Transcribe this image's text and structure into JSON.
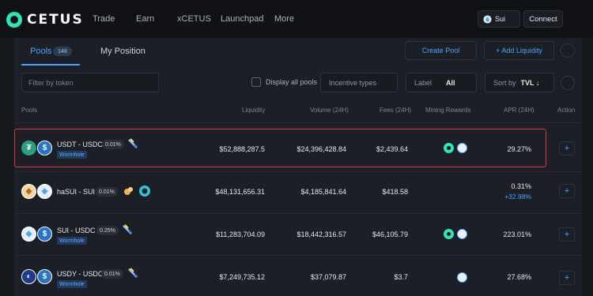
{
  "brand": {
    "name": "CETUS",
    "accent": "#2ee6b6",
    "link": "#4aa3ff",
    "highlight": "#e0323a"
  },
  "nav": {
    "items": [
      "Trade",
      "Earn",
      "xCETUS",
      "Launchpad",
      "More"
    ],
    "chain": "Sui",
    "connect": "Connect"
  },
  "tabs": {
    "pools": "Pools",
    "pools_count": "148",
    "my_position": "My Position"
  },
  "actions": {
    "create_pool": "Create Pool",
    "add_liquidity": "+ Add Liquidity"
  },
  "filters": {
    "token_placeholder": "Filter by token",
    "display_all": "Display all pools",
    "incentive": "Incentive types",
    "label_prefix": "Label",
    "label_value": "All",
    "sort_prefix": "Sort by",
    "sort_value": "TVL ↓"
  },
  "columns": [
    "Pools",
    "Liquidity",
    "Volume (24H)",
    "Fees (24H)",
    "Mining Rewards",
    "APR (24H)",
    "Action"
  ],
  "pools": [
    {
      "pair": "USDT - USDC",
      "fee": "0.01%",
      "badge": "Wormhole",
      "coin_a": "usdt-icon",
      "coin_b": "usdc-icon",
      "liquidity": "$52,888,287.5",
      "volume": "$24,396,428.84",
      "fees": "$2,439.64",
      "apr": "29.27%",
      "apr_extra": "",
      "rewards": [
        "cetus",
        "sui"
      ],
      "selected": true
    },
    {
      "pair": "haSUI - SUI",
      "fee": "0.01%",
      "badge": "",
      "coin_a": "hasui-icon",
      "coin_b": "sui-icon",
      "liquidity": "$48,131,656.31",
      "volume": "$4,185,841.64",
      "fees": "$418.58",
      "apr": "0.31%",
      "apr_extra": "+32.98%",
      "rewards": [],
      "selected": false
    },
    {
      "pair": "SUI - USDC",
      "fee": "0.25%",
      "badge": "Wormhole",
      "coin_a": "sui-icon",
      "coin_b": "usdc-icon",
      "liquidity": "$11,283,704.09",
      "volume": "$18,442,316.57",
      "fees": "$46,105.79",
      "apr": "223.01%",
      "apr_extra": "",
      "rewards": [
        "cetus",
        "sui"
      ],
      "selected": false
    },
    {
      "pair": "USDY - USDC",
      "fee": "0.01%",
      "badge": "Wormhole",
      "coin_a": "usdy-icon",
      "coin_b": "usdc-icon",
      "liquidity": "$7,249,735.12",
      "volume": "$37,079.87",
      "fees": "$3.7",
      "apr": "27.68%",
      "apr_extra": "",
      "rewards": [
        "sui"
      ],
      "selected": false
    }
  ],
  "add_symbol": "+"
}
